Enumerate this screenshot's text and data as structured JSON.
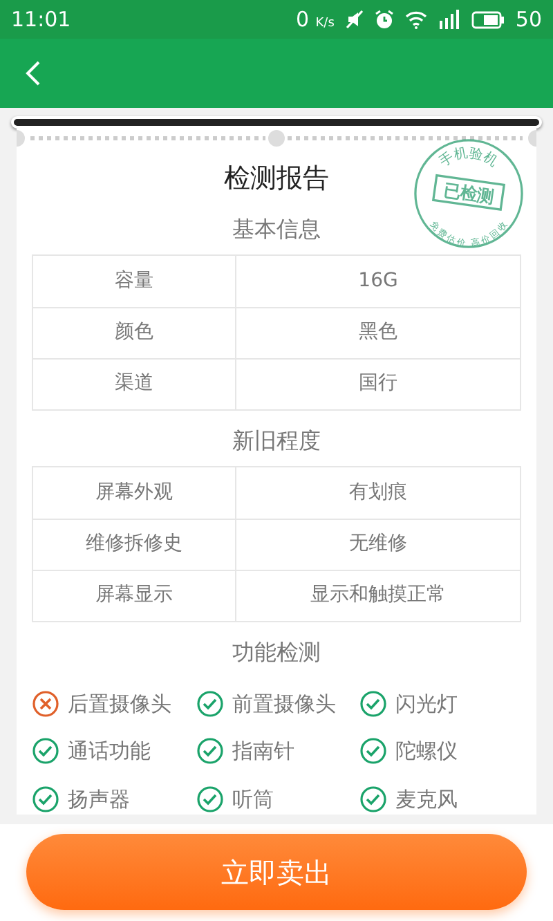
{
  "status_bar": {
    "time": "11:01",
    "speed": "0",
    "speed_unit": "K/s",
    "battery_level": "50"
  },
  "report": {
    "title": "检测报告",
    "stamp": {
      "top": "手机验机",
      "center": "已检测",
      "bottom": "免费估价 高价回收"
    },
    "sections": [
      {
        "heading": "基本信息",
        "rows": [
          {
            "label": "容量",
            "value": "16G"
          },
          {
            "label": "颜色",
            "value": "黑色"
          },
          {
            "label": "渠道",
            "value": "国行"
          }
        ]
      },
      {
        "heading": "新旧程度",
        "rows": [
          {
            "label": "屏幕外观",
            "value": "有划痕"
          },
          {
            "label": "维修拆修史",
            "value": "无维修"
          },
          {
            "label": "屏幕显示",
            "value": "显示和触摸正常"
          }
        ]
      }
    ],
    "function_heading": "功能检测",
    "checks": [
      {
        "label": "后置摄像头",
        "passed": false
      },
      {
        "label": "前置摄像头",
        "passed": true
      },
      {
        "label": "闪光灯",
        "passed": true
      },
      {
        "label": "通话功能",
        "passed": true
      },
      {
        "label": "指南针",
        "passed": true
      },
      {
        "label": "陀螺仪",
        "passed": true
      },
      {
        "label": "扬声器",
        "passed": true
      },
      {
        "label": "听筒",
        "passed": true
      },
      {
        "label": "麦克风",
        "passed": true
      }
    ]
  },
  "sell_button": "立即卖出"
}
